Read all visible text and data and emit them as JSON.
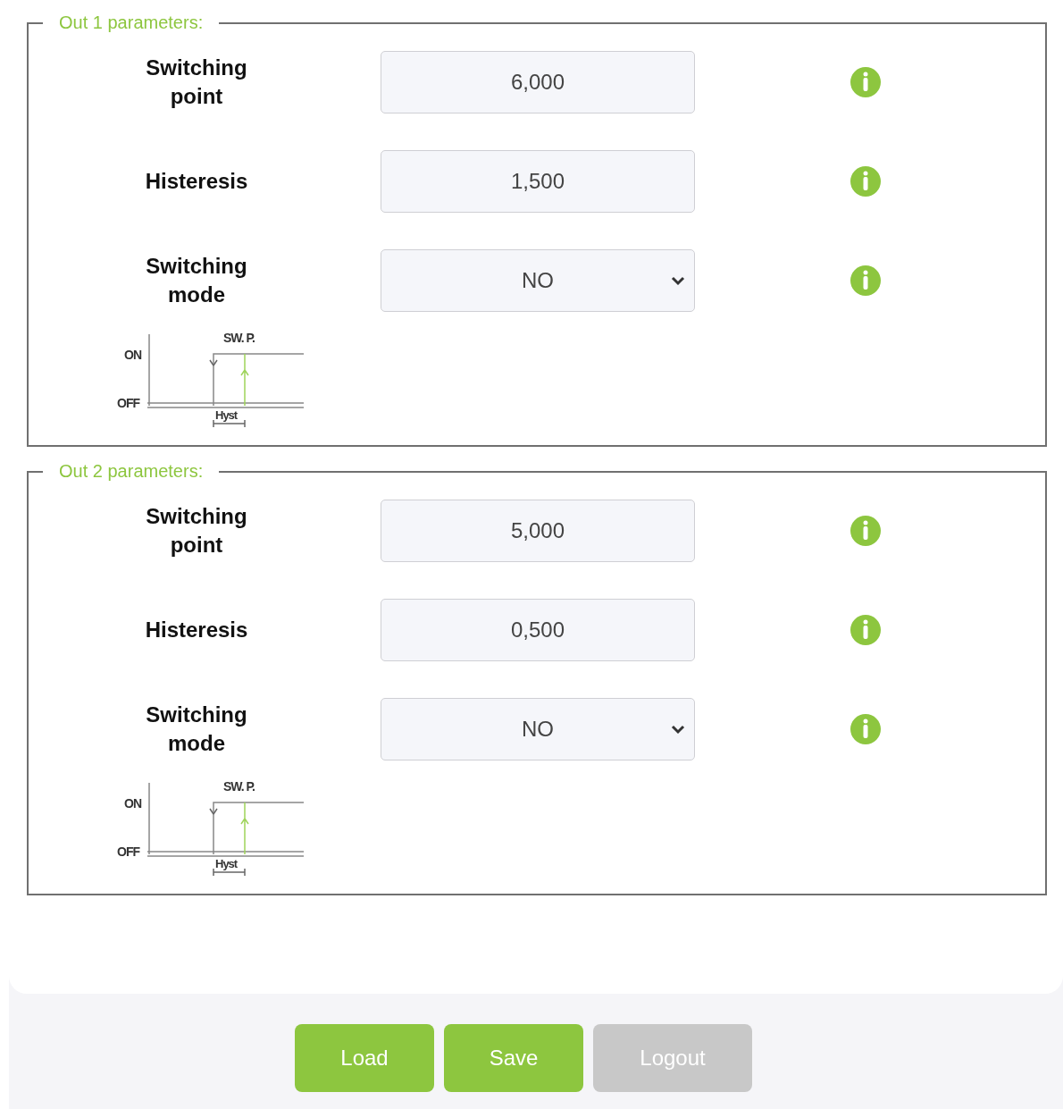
{
  "sections": [
    {
      "legend": "Out 1 parameters:",
      "rows": [
        {
          "kind": "input",
          "label": "Switching point",
          "value": "6,000"
        },
        {
          "kind": "input",
          "label": "Histeresis",
          "value": "1,500"
        },
        {
          "kind": "select",
          "label": "Switching mode",
          "value": "NO"
        }
      ],
      "diagram": {
        "on": "ON",
        "off": "OFF",
        "switch": "SW. P.",
        "hyst": "Hyst"
      }
    },
    {
      "legend": "Out 2 parameters:",
      "rows": [
        {
          "kind": "input",
          "label": "Switching point",
          "value": "5,000"
        },
        {
          "kind": "input",
          "label": "Histeresis",
          "value": "0,500"
        },
        {
          "kind": "select",
          "label": "Switching mode",
          "value": "NO"
        }
      ],
      "diagram": {
        "on": "ON",
        "off": "OFF",
        "switch": "SW. P.",
        "hyst": "Hyst"
      }
    }
  ],
  "buttons": [
    {
      "label": "Load",
      "disabled": false
    },
    {
      "label": "Save",
      "disabled": false
    },
    {
      "label": "Logout",
      "disabled": true
    }
  ]
}
